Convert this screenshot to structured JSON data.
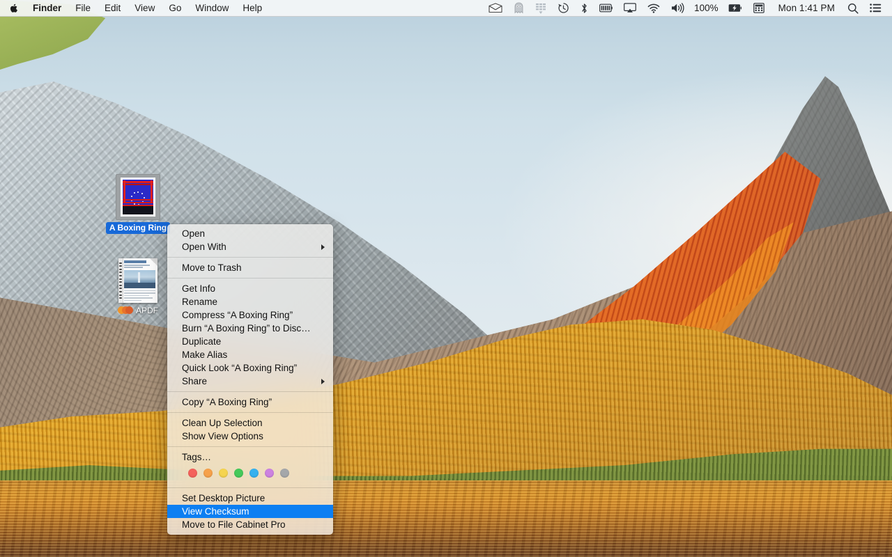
{
  "menubar": {
    "apple_icon": "apple-logo-icon",
    "left_items": [
      {
        "label": "Finder",
        "bold": true
      },
      {
        "label": "File",
        "bold": false
      },
      {
        "label": "Edit",
        "bold": false
      },
      {
        "label": "View",
        "bold": false
      },
      {
        "label": "Go",
        "bold": false
      },
      {
        "label": "Window",
        "bold": false
      },
      {
        "label": "Help",
        "bold": false
      }
    ],
    "status_icons": [
      "mail-envelope-icon",
      "ghost-icon",
      "equalizer-sliders-icon",
      "time-machine-icon",
      "bluetooth-icon",
      "battery-meter-icon",
      "airplay-icon",
      "wifi-icon",
      "volume-icon"
    ],
    "battery_percent": "100%",
    "battery_icon": "battery-charging-icon",
    "calculator_icon": "calculator-icon",
    "clock": "Mon 1:41 PM",
    "search_icon": "search-icon",
    "notification_center_icon": "notification-center-icon"
  },
  "desktop": {
    "icons": [
      {
        "name": "A Boxing Ring",
        "label": "A Boxing Ring",
        "selected": true,
        "kind": "image-thumbnail"
      },
      {
        "name": "APDF",
        "label": "APDF",
        "selected": false,
        "kind": "pdf-document",
        "badge_icon": "apdf-badge-icon"
      }
    ]
  },
  "context_menu": {
    "groups": [
      {
        "items": [
          {
            "label": "Open",
            "submenu": false,
            "selected": false
          },
          {
            "label": "Open With",
            "submenu": true,
            "selected": false
          }
        ]
      },
      {
        "items": [
          {
            "label": "Move to Trash",
            "submenu": false,
            "selected": false
          }
        ]
      },
      {
        "items": [
          {
            "label": "Get Info",
            "submenu": false,
            "selected": false
          },
          {
            "label": "Rename",
            "submenu": false,
            "selected": false
          },
          {
            "label": "Compress “A Boxing Ring”",
            "submenu": false,
            "selected": false
          },
          {
            "label": "Burn “A Boxing Ring” to Disc…",
            "submenu": false,
            "selected": false
          },
          {
            "label": "Duplicate",
            "submenu": false,
            "selected": false
          },
          {
            "label": "Make Alias",
            "submenu": false,
            "selected": false
          },
          {
            "label": "Quick Look “A Boxing Ring”",
            "submenu": false,
            "selected": false
          },
          {
            "label": "Share",
            "submenu": true,
            "selected": false
          }
        ]
      },
      {
        "items": [
          {
            "label": "Copy “A Boxing Ring”",
            "submenu": false,
            "selected": false
          }
        ]
      },
      {
        "items": [
          {
            "label": "Clean Up Selection",
            "submenu": false,
            "selected": false
          },
          {
            "label": "Show View Options",
            "submenu": false,
            "selected": false
          }
        ]
      },
      {
        "items": [
          {
            "label": "Tags…",
            "submenu": false,
            "selected": false
          }
        ],
        "tags": [
          {
            "name": "tag-red",
            "color": "#f4625c"
          },
          {
            "name": "tag-orange",
            "color": "#f6a14b"
          },
          {
            "name": "tag-yellow",
            "color": "#f5d košta"
          },
          {
            "name": "tag-green",
            "color": "#45c95a"
          },
          {
            "name": "tag-blue",
            "color": "#35b1ef"
          },
          {
            "name": "tag-purple",
            "color": "#cc82e0"
          },
          {
            "name": "tag-gray",
            "color": "#a4a7aa"
          }
        ]
      },
      {
        "items": [
          {
            "label": "Set Desktop Picture",
            "submenu": false,
            "selected": false
          },
          {
            "label": "View Checksum",
            "submenu": false,
            "selected": true
          },
          {
            "label": "Move to File Cabinet Pro",
            "submenu": false,
            "selected": false
          }
        ]
      }
    ],
    "highlight_color": "#0d7ff2"
  },
  "colors": {
    "selection_blue": "#0d7ff2",
    "label_selected_blue": "#1769d8",
    "menubar_bg": "#f6f7f8"
  }
}
